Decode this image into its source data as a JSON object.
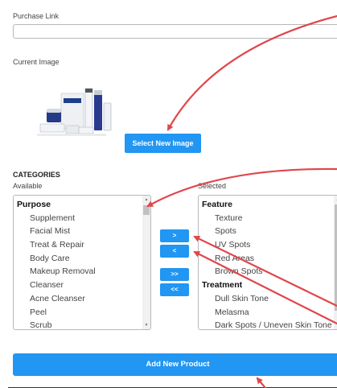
{
  "purchase": {
    "label": "Purchase Link",
    "value": ""
  },
  "current_image": {
    "label": "Current Image",
    "alt": "product-box-and-bottles"
  },
  "select_image_button": "Select New Image",
  "categories": {
    "heading": "CATEGORIES",
    "available_label": "Available",
    "selected_label": "Selected",
    "available": [
      {
        "group": "Purpose",
        "items": [
          "Supplement",
          "Facial Mist",
          "Treat & Repair",
          "Body Care",
          "Makeup Removal",
          "Cleanser",
          "Acne Cleanser",
          "Peel",
          "Scrub"
        ]
      }
    ],
    "selected": [
      {
        "group": "Feature",
        "items": [
          "Texture",
          "Spots",
          "UV Spots",
          "Red Areas",
          "Brown Spots"
        ]
      },
      {
        "group": "Treatment",
        "items": [
          "Dull Skin Tone",
          "Melasma",
          "Dark Spots / Uneven Skin Tone"
        ]
      }
    ],
    "move_buttons": {
      "add": ">",
      "remove": "<",
      "add_all": ">>",
      "remove_all": "<<"
    }
  },
  "add_product_button": "Add New Product",
  "colors": {
    "accent": "#2196f3",
    "arrow": "#e0464b",
    "border": "#b8b8b8"
  },
  "icons": {
    "arrows": "red-annotation-arrow-icon",
    "scroll_up": "scroll-up-icon",
    "scroll_down": "scroll-down-icon"
  }
}
